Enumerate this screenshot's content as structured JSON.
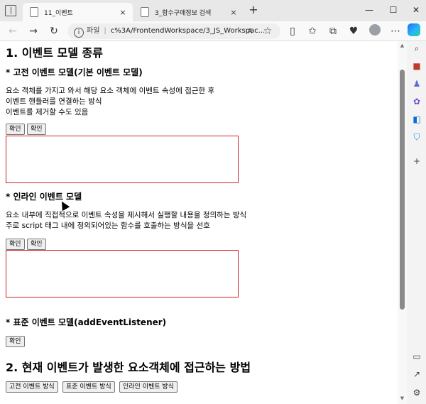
{
  "browser": {
    "tabs": [
      {
        "label": "11_이벤트",
        "close": "×"
      },
      {
        "label": "3_함수구매정보 검색",
        "close": "×"
      }
    ],
    "new_tab": "+",
    "window_controls": {
      "minimize": "—",
      "maximize": "☐",
      "close": "✕"
    },
    "address": {
      "scheme_label": "파일",
      "separator": "|",
      "url": "c%3A/FrontendWorkspace/3_JS_Workspac..."
    }
  },
  "page": {
    "h1_event_models": "1. 이벤트 모델 종류",
    "section_classic": {
      "heading": "* 고전 이벤트 모델(기본 이벤트 모델)",
      "lines": [
        "요소 객체를 가지고 와서 해당 요소 객체에 이벤트 속성에 접근한 후",
        "이벤트 핸들러를 연결하는 방식",
        "이벤트를 제거할 수도 있음"
      ],
      "buttons": [
        "확인",
        "확인"
      ]
    },
    "section_inline": {
      "heading": "* 인라인 이벤트 모델",
      "lines": [
        "요소 내부에 직접적으로 이벤트 속성을 제시해서 실행할 내용을 정의하는 방식",
        "주로 script 태그 내에 정의되어있는 함수를 호출하는 방식을 선호"
      ],
      "buttons": [
        "확인",
        "확인"
      ]
    },
    "section_standard": {
      "heading": "* 표준 이벤트 모델(addEventListener)",
      "buttons": [
        "확인"
      ]
    },
    "h2_current_target": "2. 현재 이벤트가 발생한 요소객체에 접근하는 방법",
    "bottom_buttons": [
      "고전 이벤트 방식",
      "표준 이벤트 방식",
      "인라인 이벤트 방식"
    ]
  },
  "colors": {
    "output_box_border": "#d02020",
    "accent": "#1c6ef2"
  }
}
